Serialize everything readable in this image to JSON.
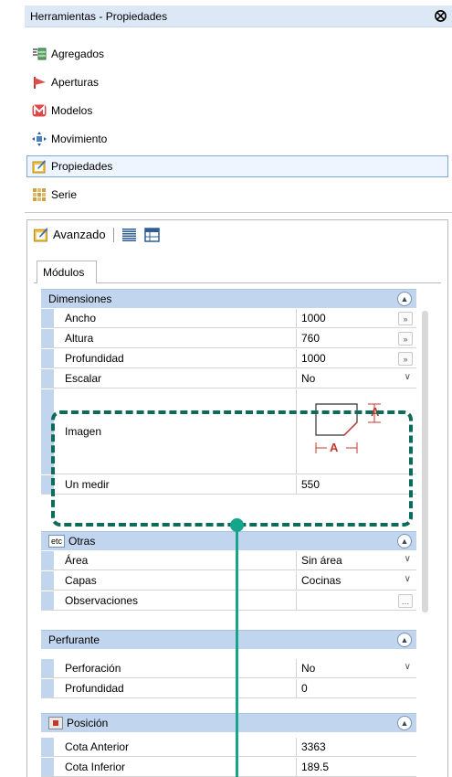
{
  "window": {
    "title": "Herramientas - Propiedades",
    "pin_icon": "pin-icon"
  },
  "toolbox": {
    "items": [
      {
        "label": "Agregados",
        "icon": "aggregates-icon"
      },
      {
        "label": "Aperturas",
        "icon": "openings-flag-icon"
      },
      {
        "label": "Modelos",
        "icon": "models-icon"
      },
      {
        "label": "Movimiento",
        "icon": "move-icon"
      },
      {
        "label": "Propiedades",
        "icon": "properties-icon",
        "selected": true
      },
      {
        "label": "Serie",
        "icon": "series-icon"
      }
    ]
  },
  "panel": {
    "title": "Avanzado",
    "tab": "Módulos"
  },
  "categories": {
    "dimensiones": {
      "label": "Dimensiones",
      "rows": [
        {
          "name": "Ancho",
          "value": "1000",
          "editor": "ellipsis"
        },
        {
          "name": "Altura",
          "value": "760",
          "editor": "ellipsis"
        },
        {
          "name": "Profundidad",
          "value": "1000",
          "editor": "ellipsis"
        },
        {
          "name": "Escalar",
          "value": "No",
          "editor": "dropdown"
        },
        {
          "name": "Imagen",
          "value": "",
          "diagram_label": "A"
        },
        {
          "name": "Un medir",
          "value": "550"
        }
      ]
    },
    "otras": {
      "label": "Otras",
      "icon_text": "etc",
      "rows": [
        {
          "name": "Área",
          "value": "Sin área",
          "editor": "dropdown"
        },
        {
          "name": "Capas",
          "value": "Cocinas",
          "editor": "dropdown"
        },
        {
          "name": "Observaciones",
          "value": "",
          "editor": "ellipsis"
        }
      ]
    },
    "perfurante": {
      "label": "Perfurante",
      "rows": [
        {
          "name": "Perforación",
          "value": "No",
          "editor": "dropdown"
        },
        {
          "name": "Profundidad",
          "value": "0"
        }
      ]
    },
    "posicion": {
      "label": "Posición",
      "rows": [
        {
          "name": "Cota Anterior",
          "value": "3363"
        },
        {
          "name": "Cota Inferior",
          "value": "189.5"
        }
      ]
    }
  },
  "colors": {
    "category_bg": "#c1d6ee",
    "highlight": "#0e6b5a",
    "connector": "#14a58a",
    "dim_red": "#c0392b"
  }
}
